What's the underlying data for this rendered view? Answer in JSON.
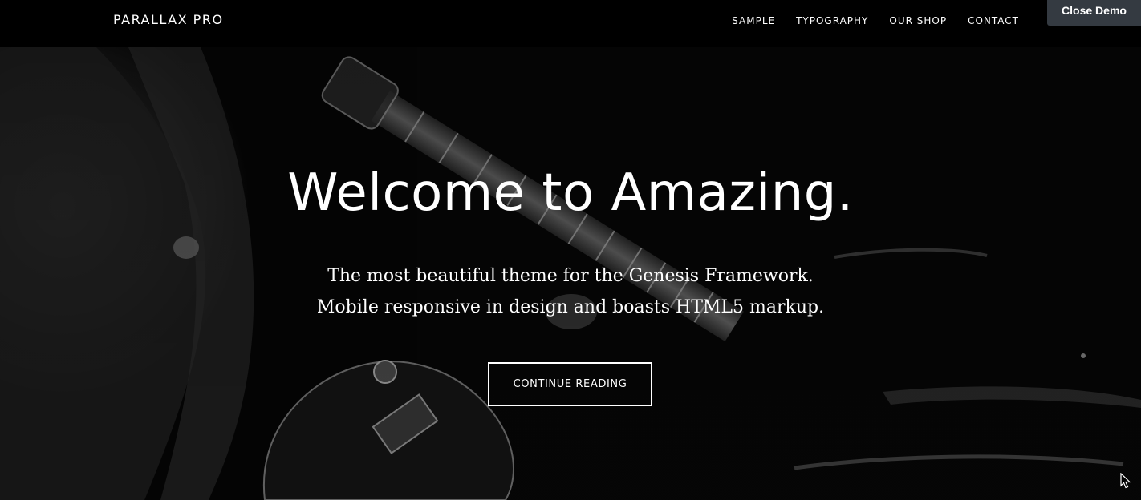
{
  "header": {
    "site_title": "PARALLAX PRO",
    "nav": [
      "SAMPLE",
      "TYPOGRAPHY",
      "OUR SHOP",
      "CONTACT"
    ]
  },
  "demo_bar": {
    "close_label": "Close Demo"
  },
  "hero": {
    "title": "Welcome to Amazing.",
    "subtitle_line1": "The most beautiful theme for the Genesis Framework.",
    "subtitle_line2": "Mobile responsive in design and boasts HTML5 markup.",
    "cta_label": "CONTINUE READING"
  },
  "colors": {
    "header_bg": "#000000",
    "close_demo_bg": "#343a41",
    "text": "#ffffff"
  },
  "icons": [
    "guitar-photo-background",
    "mouse-cursor-icon"
  ]
}
